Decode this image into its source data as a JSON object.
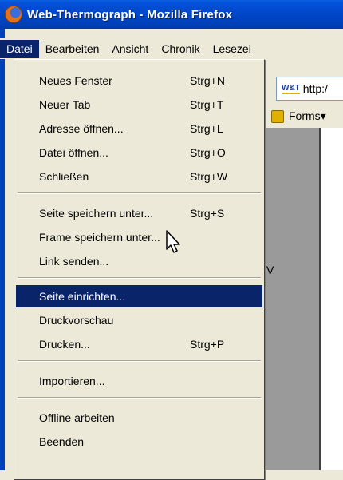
{
  "window": {
    "title": "Web-Thermograph - Mozilla Firefox"
  },
  "menubar": {
    "items": [
      {
        "label": "Datei",
        "active": true
      },
      {
        "label": "Bearbeiten"
      },
      {
        "label": "Ansicht"
      },
      {
        "label": "Chronik"
      },
      {
        "label": "Lesezei"
      }
    ]
  },
  "browser": {
    "url_icon": "W&T",
    "url_text": "http:/",
    "forms_label": "Forms▾",
    "partial_text": "V"
  },
  "menu": {
    "items": [
      {
        "label": "Neues Fenster",
        "shortcut": "Strg+N"
      },
      {
        "label": "Neuer Tab",
        "shortcut": "Strg+T"
      },
      {
        "label": "Adresse öffnen...",
        "shortcut": "Strg+L"
      },
      {
        "label": "Datei öffnen...",
        "shortcut": "Strg+O"
      },
      {
        "label": "Schließen",
        "shortcut": "Strg+W"
      },
      {
        "label": "Seite speichern unter...",
        "shortcut": "Strg+S"
      },
      {
        "label": "Frame speichern unter...",
        "shortcut": ""
      },
      {
        "label": "Link senden...",
        "shortcut": ""
      },
      {
        "label": "Seite einrichten...",
        "shortcut": "",
        "selected": true
      },
      {
        "label": "Druckvorschau",
        "shortcut": ""
      },
      {
        "label": "Drucken...",
        "shortcut": "Strg+P"
      },
      {
        "label": "Importieren...",
        "shortcut": ""
      },
      {
        "label": "Offline arbeiten",
        "shortcut": ""
      },
      {
        "label": "Beenden",
        "shortcut": ""
      }
    ]
  },
  "colors": {
    "titlebar": "#0046c8",
    "selection": "#0a246a",
    "menu_bg": "#ece9d8"
  }
}
